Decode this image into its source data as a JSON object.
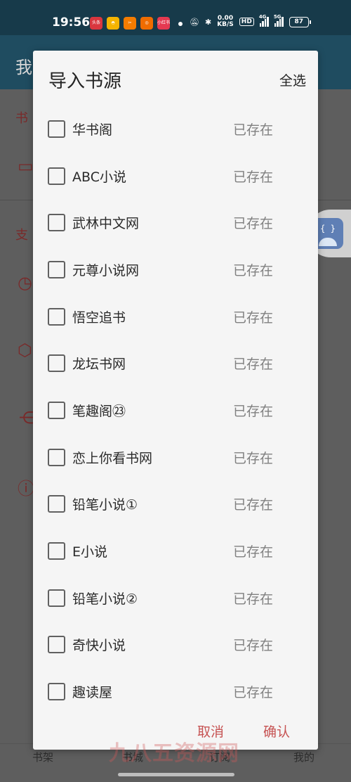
{
  "statusbar": {
    "time": "19:56",
    "apps": [
      {
        "icon": "toutiao-icon",
        "label": "头条",
        "color": "#d9363e"
      },
      {
        "icon": "meituan-icon",
        "label": "美团",
        "color": "#f4b400"
      },
      {
        "icon": "app-orange-icon",
        "label": "",
        "color": "#f57c00"
      },
      {
        "icon": "app-orange2-icon",
        "label": "",
        "color": "#ef6c00"
      },
      {
        "icon": "xiaohongshu-icon",
        "label": "小红书",
        "color": "#e53950"
      }
    ],
    "speed_value": "0.00",
    "speed_unit": "KB/S",
    "hd": "HD",
    "net1": "4G",
    "net2": "5G",
    "battery": "87"
  },
  "background": {
    "header_title": "我",
    "text_1": "书",
    "text_2": "支",
    "bottom_nav": [
      "书架",
      "书城",
      "订阅",
      "我的"
    ]
  },
  "dialog": {
    "title": "导入书源",
    "select_all": "全选",
    "items": [
      {
        "name": "华书阁",
        "status": "已存在"
      },
      {
        "name": " ABC小说",
        "status": "已存在"
      },
      {
        "name": "武林中文网",
        "status": "已存在"
      },
      {
        "name": " 元尊小说网",
        "status": "已存在"
      },
      {
        "name": "悟空追书",
        "status": "已存在"
      },
      {
        "name": "龙坛书网",
        "status": "已存在"
      },
      {
        "name": "笔趣阁㉓",
        "status": "已存在"
      },
      {
        "name": "恋上你看书网",
        "status": "已存在"
      },
      {
        "name": "铅笔小说①",
        "status": "已存在"
      },
      {
        "name": "E小说",
        "status": "已存在"
      },
      {
        "name": "铅笔小说②",
        "status": "已存在"
      },
      {
        "name": "奇快小说",
        "status": "已存在"
      },
      {
        "name": "趣读屋",
        "status": "已存在"
      }
    ],
    "cancel": "取消",
    "confirm": "确认"
  },
  "watermark": "九八五资源网",
  "colors": {
    "accent": "#c65353",
    "dialog_bg": "#f5f5f5",
    "header_bg": "#1f4c60"
  }
}
